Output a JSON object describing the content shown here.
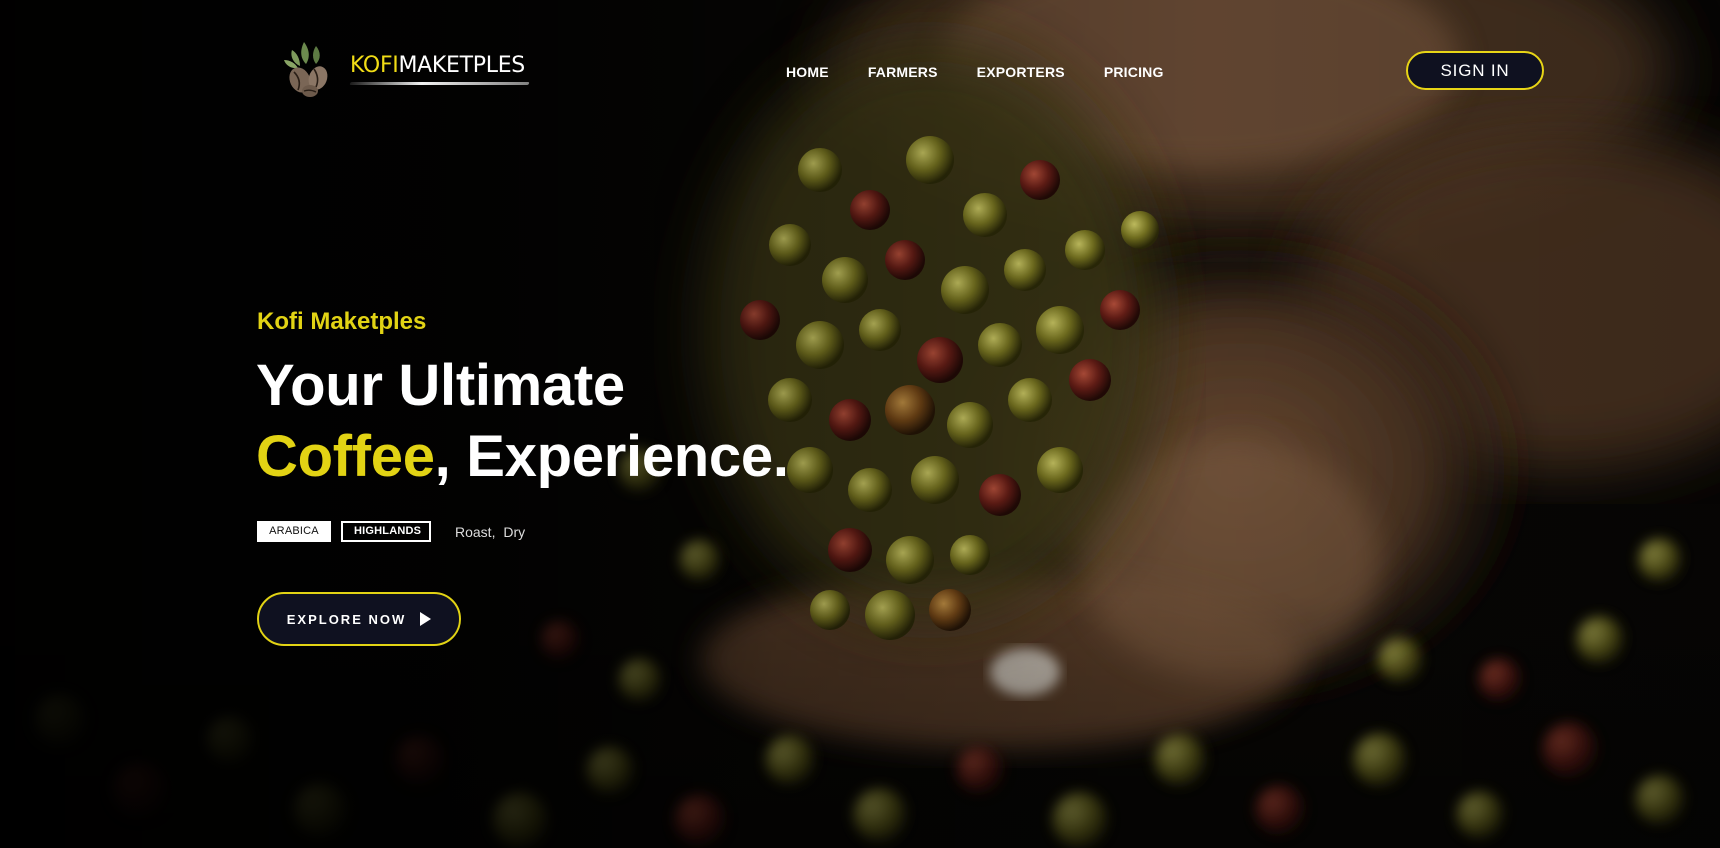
{
  "brand": {
    "logo_part1": "KOFI",
    "logo_part2": "MAKETPLES",
    "logo_icon": "coffee-beans-leaf-icon"
  },
  "nav": {
    "items": [
      {
        "label": "HOME"
      },
      {
        "label": "FARMERS"
      },
      {
        "label": "EXPORTERS"
      },
      {
        "label": "PRICING"
      }
    ],
    "signin_label": "SIGN IN"
  },
  "hero": {
    "eyebrow": "Kofi Maketples",
    "headline_line1": "Your Ultimate",
    "headline_accent": "Coffee",
    "headline_rest": ", Experience.",
    "tags": {
      "tag1": "ARABICA",
      "tag2": "HIGHLANDS",
      "extra": "Roast,  Dry"
    },
    "cta_label": "EXPLORE NOW",
    "cta_icon": "play-icon",
    "background": "coffee-cherries-in-hands-photo"
  },
  "colors": {
    "accent": "#e2d314",
    "button_bg": "#0f1120",
    "text": "#ffffff"
  }
}
